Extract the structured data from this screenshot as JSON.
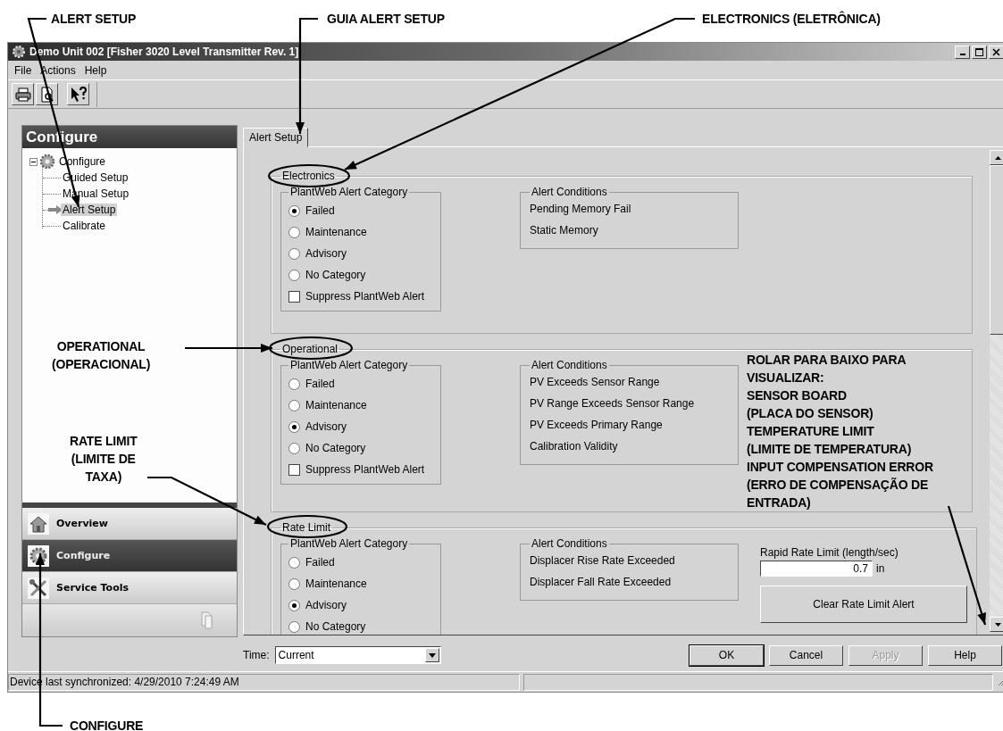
{
  "window": {
    "title": "Demo Unit 002 [Fisher 3020 Level Transmitter Rev. 1]"
  },
  "menu": [
    "File",
    "Actions",
    "Help"
  ],
  "sidebar": {
    "title": "Configure",
    "tree": {
      "label": "Configure",
      "expanded": true,
      "children": [
        {
          "label": "Guided Setup",
          "selected": false
        },
        {
          "label": "Manual Setup",
          "selected": false
        },
        {
          "label": "Alert Setup",
          "selected": true
        },
        {
          "label": "Calibrate",
          "selected": false
        }
      ]
    },
    "nav": [
      {
        "label": "Overview",
        "selected": false
      },
      {
        "label": "Configure",
        "selected": true
      },
      {
        "label": "Service Tools",
        "selected": false
      }
    ]
  },
  "tabs": [
    {
      "label": "Alert Setup",
      "selected": true
    }
  ],
  "sections": [
    {
      "title": "Electronics",
      "category": {
        "legend": "PlantWeb Alert Category",
        "options": [
          {
            "label": "Failed",
            "selected": true
          },
          {
            "label": "Maintenance",
            "selected": false
          },
          {
            "label": "Advisory",
            "selected": false
          },
          {
            "label": "No Category",
            "selected": false
          }
        ],
        "suppress": {
          "label": "Suppress PlantWeb Alert",
          "checked": false
        }
      },
      "conditions": {
        "legend": "Alert Conditions",
        "items": [
          "Pending Memory Fail",
          "Static Memory"
        ]
      }
    },
    {
      "title": "Operational",
      "category": {
        "legend": "PlantWeb Alert Category",
        "options": [
          {
            "label": "Failed",
            "selected": false
          },
          {
            "label": "Maintenance",
            "selected": false
          },
          {
            "label": "Advisory",
            "selected": true
          },
          {
            "label": "No Category",
            "selected": false
          }
        ],
        "suppress": {
          "label": "Suppress PlantWeb Alert",
          "checked": false
        }
      },
      "conditions": {
        "legend": "Alert Conditions",
        "items": [
          "PV Exceeds Sensor Range",
          "PV Range Exceeds Sensor Range",
          "PV Exceeds Primary Range",
          "Calibration Validity"
        ]
      }
    },
    {
      "title": "Rate Limit",
      "category": {
        "legend": "PlantWeb Alert Category",
        "options": [
          {
            "label": "Failed",
            "selected": false
          },
          {
            "label": "Maintenance",
            "selected": false
          },
          {
            "label": "Advisory",
            "selected": true
          },
          {
            "label": "No Category",
            "selected": false
          }
        ]
      },
      "conditions": {
        "legend": "Alert Conditions",
        "items": [
          "Displacer Rise Rate Exceeded",
          "Displacer Fall Rate Exceeded"
        ]
      },
      "rate_limit": {
        "label": "Rapid Rate Limit (length/sec)",
        "value": "0.7",
        "unit": "in",
        "button": "Clear Rate Limit Alert"
      }
    }
  ],
  "time": {
    "label": "Time:",
    "value": "Current"
  },
  "buttons": [
    {
      "label": "OK",
      "default": true,
      "disabled": false
    },
    {
      "label": "Cancel",
      "default": false,
      "disabled": false
    },
    {
      "label": "Apply",
      "default": false,
      "disabled": true
    },
    {
      "label": "Help",
      "default": false,
      "disabled": false
    }
  ],
  "status_bar": {
    "text": "Device last synchronized: 4/29/2010 7:24:49 AM"
  },
  "callouts": [
    {
      "text": "ALERT SETUP"
    },
    {
      "text": "GUIA ALERT SETUP"
    },
    {
      "text": "ELECTRONICS (ELETRÔNICA)"
    },
    {
      "text": "OPERATIONAL\n(OPERACIONAL)"
    },
    {
      "text": "RATE LIMIT\n(LIMITE DE\nTAXA)"
    },
    {
      "text": "CONFIGURE"
    },
    {
      "text": "ROLAR PARA BAIXO PARA\nVISUALIZAR:\nSENSOR BOARD\n(PLACA DO SENSOR)\nTEMPERATURE LIMIT\n(LIMITE DE TEMPERATURA)\nINPUT COMPENSATION ERROR\n(ERRO DE COMPENSAÇÃO DE\nENTRADA)"
    }
  ]
}
